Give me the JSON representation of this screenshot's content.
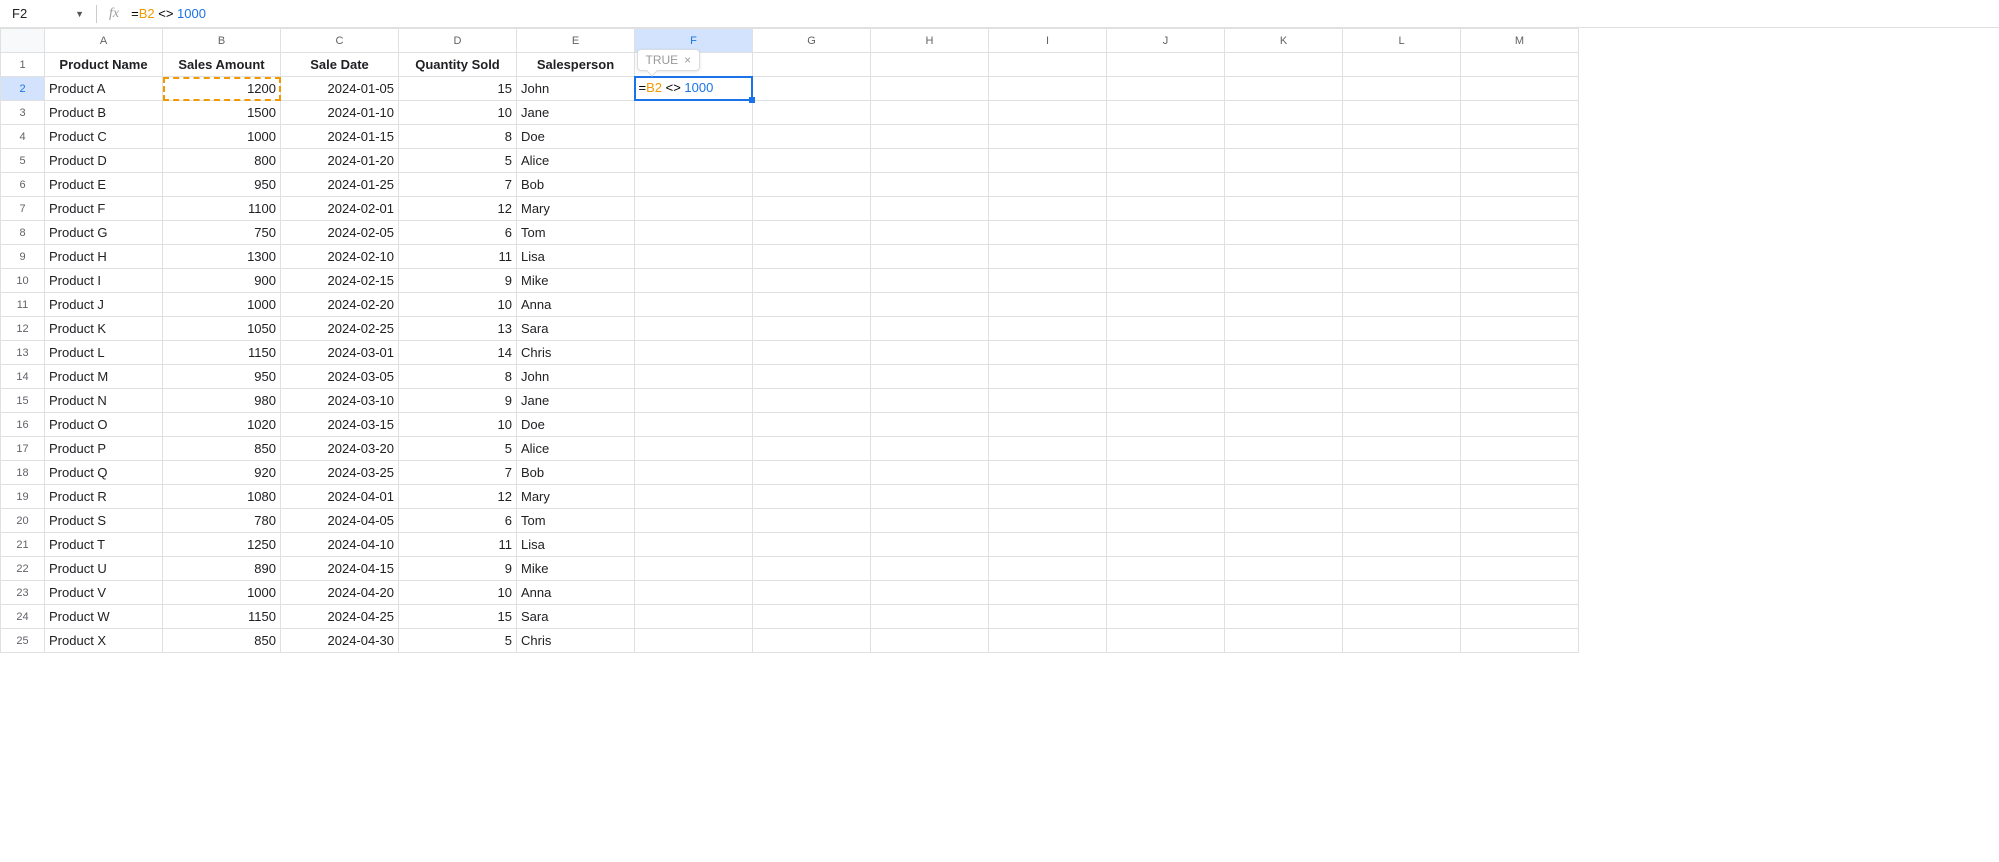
{
  "nameBox": {
    "value": "F2"
  },
  "formula": {
    "eq": "=",
    "ref": "B2",
    "op": " <> ",
    "num": "1000"
  },
  "tooltip": {
    "value": "TRUE",
    "close": "×"
  },
  "columns": [
    "A",
    "B",
    "C",
    "D",
    "E",
    "F",
    "G",
    "H",
    "I",
    "J",
    "K",
    "L",
    "M"
  ],
  "activeColumn": "F",
  "activeRow": 2,
  "copiedCell": {
    "row": 2,
    "col": 1
  },
  "headers": [
    "Product Name",
    "Sales Amount",
    "Sale Date",
    "Quantity Sold",
    "Salesperson"
  ],
  "rows": [
    {
      "n": 1
    },
    {
      "n": 2,
      "name": "Product A",
      "amount": "1200",
      "date": "2024-01-05",
      "qty": "15",
      "person": "John"
    },
    {
      "n": 3,
      "name": "Product B",
      "amount": "1500",
      "date": "2024-01-10",
      "qty": "10",
      "person": "Jane"
    },
    {
      "n": 4,
      "name": "Product C",
      "amount": "1000",
      "date": "2024-01-15",
      "qty": "8",
      "person": "Doe"
    },
    {
      "n": 5,
      "name": "Product D",
      "amount": "800",
      "date": "2024-01-20",
      "qty": "5",
      "person": "Alice"
    },
    {
      "n": 6,
      "name": "Product E",
      "amount": "950",
      "date": "2024-01-25",
      "qty": "7",
      "person": "Bob"
    },
    {
      "n": 7,
      "name": "Product F",
      "amount": "1100",
      "date": "2024-02-01",
      "qty": "12",
      "person": "Mary"
    },
    {
      "n": 8,
      "name": "Product G",
      "amount": "750",
      "date": "2024-02-05",
      "qty": "6",
      "person": "Tom"
    },
    {
      "n": 9,
      "name": "Product H",
      "amount": "1300",
      "date": "2024-02-10",
      "qty": "11",
      "person": "Lisa"
    },
    {
      "n": 10,
      "name": "Product I",
      "amount": "900",
      "date": "2024-02-15",
      "qty": "9",
      "person": "Mike"
    },
    {
      "n": 11,
      "name": "Product J",
      "amount": "1000",
      "date": "2024-02-20",
      "qty": "10",
      "person": "Anna"
    },
    {
      "n": 12,
      "name": "Product K",
      "amount": "1050",
      "date": "2024-02-25",
      "qty": "13",
      "person": "Sara"
    },
    {
      "n": 13,
      "name": "Product L",
      "amount": "1150",
      "date": "2024-03-01",
      "qty": "14",
      "person": "Chris"
    },
    {
      "n": 14,
      "name": "Product M",
      "amount": "950",
      "date": "2024-03-05",
      "qty": "8",
      "person": "John"
    },
    {
      "n": 15,
      "name": "Product N",
      "amount": "980",
      "date": "2024-03-10",
      "qty": "9",
      "person": "Jane"
    },
    {
      "n": 16,
      "name": "Product O",
      "amount": "1020",
      "date": "2024-03-15",
      "qty": "10",
      "person": "Doe"
    },
    {
      "n": 17,
      "name": "Product P",
      "amount": "850",
      "date": "2024-03-20",
      "qty": "5",
      "person": "Alice"
    },
    {
      "n": 18,
      "name": "Product Q",
      "amount": "920",
      "date": "2024-03-25",
      "qty": "7",
      "person": "Bob"
    },
    {
      "n": 19,
      "name": "Product R",
      "amount": "1080",
      "date": "2024-04-01",
      "qty": "12",
      "person": "Mary"
    },
    {
      "n": 20,
      "name": "Product S",
      "amount": "780",
      "date": "2024-04-05",
      "qty": "6",
      "person": "Tom"
    },
    {
      "n": 21,
      "name": "Product T",
      "amount": "1250",
      "date": "2024-04-10",
      "qty": "11",
      "person": "Lisa"
    },
    {
      "n": 22,
      "name": "Product U",
      "amount": "890",
      "date": "2024-04-15",
      "qty": "9",
      "person": "Mike"
    },
    {
      "n": 23,
      "name": "Product V",
      "amount": "1000",
      "date": "2024-04-20",
      "qty": "10",
      "person": "Anna"
    },
    {
      "n": 24,
      "name": "Product W",
      "amount": "1150",
      "date": "2024-04-25",
      "qty": "15",
      "person": "Sara"
    },
    {
      "n": 25,
      "name": "Product X",
      "amount": "850",
      "date": "2024-04-30",
      "qty": "5",
      "person": "Chris"
    }
  ],
  "colWidths": {
    "rowhdr": 44,
    "A": 118,
    "B": 118,
    "C": 118,
    "D": 118,
    "E": 118,
    "F": 118,
    "G": 118,
    "H": 118,
    "I": 118,
    "J": 118,
    "K": 118,
    "L": 118,
    "M": 118
  }
}
